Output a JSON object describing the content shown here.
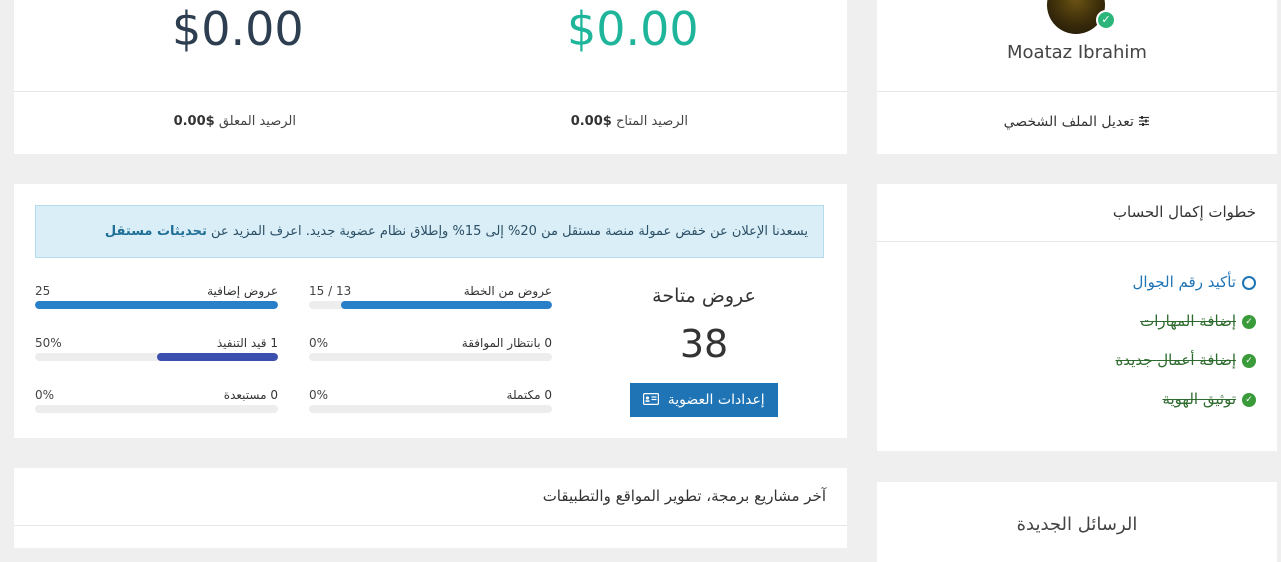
{
  "balance": {
    "pending_amount": "$0.00",
    "available_amount": "$0.00",
    "pending_label": "الرصيد المعلق",
    "pending_value": "$0.00",
    "available_label": "الرصيد المتاح",
    "available_value": "$0.00",
    "colors": {
      "pending": "#2d3e50",
      "available": "#1fb59a"
    }
  },
  "profile": {
    "name": "Moataz Ibrahim",
    "edit_label": "تعديل الملف الشخصي",
    "edit_icon": "sliders-icon",
    "verified_icon": "check-circle-icon"
  },
  "offers": {
    "notice_text": "يسعدنا الإعلان عن خفض عمولة منصة مستقل من 20% إلى 15% وإطلاق نظام عضوية جديد. اعرف المزيد عن",
    "notice_link": "تحديثات مستقل",
    "available_title": "عروض متاحة",
    "available_count": "38",
    "membership_button": "إعدادات العضوية",
    "membership_icon": "id-card-icon",
    "stats": [
      {
        "label": "عروض من الخطة",
        "value": "15 / 13",
        "progress": 0.87,
        "color": "#2a7fc9"
      },
      {
        "label": "عروض إضافية",
        "value": "25",
        "progress": 1.0,
        "color": "#2a7fc9"
      },
      {
        "label": "0 بانتظار الموافقة",
        "value": "0%",
        "progress": 0,
        "color": "#2a7fc9"
      },
      {
        "label": "1 قيد التنفيذ",
        "value": "50%",
        "progress": 0.5,
        "color": "#3a4fae"
      },
      {
        "label": "0 مكتملة",
        "value": "0%",
        "progress": 0,
        "color": "#2a7fc9"
      },
      {
        "label": "0 مستبعدة",
        "value": "0%",
        "progress": 0,
        "color": "#2a7fc9"
      }
    ]
  },
  "steps": {
    "title": "خطوات إكمال الحساب",
    "items": [
      {
        "label": "تأكيد رقم الجوال",
        "status": "pending"
      },
      {
        "label": "إضافة المهارات",
        "status": "done"
      },
      {
        "label": "إضافة أعمال جديدة",
        "status": "done"
      },
      {
        "label": "توثيق الهوية",
        "status": "done"
      }
    ]
  },
  "projects": {
    "title": "آخر مشاريع برمجة، تطوير المواقع والتطبيقات"
  },
  "messages": {
    "title": "الرسائل الجديدة"
  }
}
